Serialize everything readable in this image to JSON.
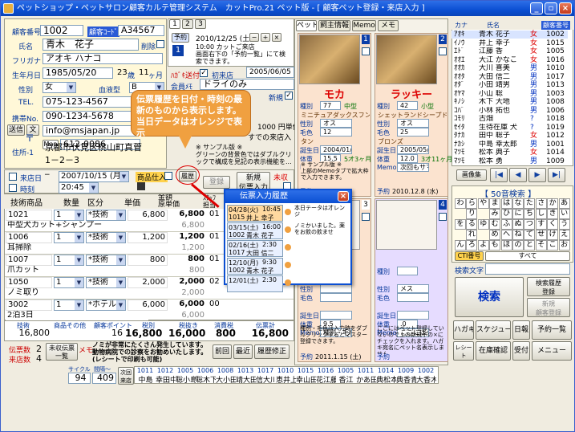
{
  "window": {
    "title": "ペットショップ・ペットサロン顧客カルテ管理システム　カットPro.21 ペット版 - [ 顧客ペット登録・来店入力 ]"
  },
  "customer": {
    "id_label": "顧客番号",
    "id": "1002",
    "code_label": "顧客ｺｰﾄﾞ",
    "code": "A34567",
    "name_label": "氏名",
    "name": "青木　花子",
    "delete_label": "削除",
    "kana_label": "フリガナ",
    "kana": "アオキ ハナコ",
    "birth_label": "生年月日",
    "birth": "1985/05/20",
    "age": "23",
    "age_unit": "歳",
    "months": "11",
    "month_unit": "ヶ月",
    "gender_label": "性別",
    "gender": "女",
    "blood_label": "血液型",
    "blood": "B",
    "dm_label": "ﾊｶﾞｷ送付",
    "first_visit_label": "初来店",
    "first_visit": "2005/06/05",
    "memo_label": "会員ﾒﾓ",
    "memo": "ドライのみ",
    "tel_label": "TEL.",
    "tel": "075-123-4567",
    "new_label": "新規",
    "mobile_label": "携帯No.",
    "mobile": "090-1234-5678",
    "mail_label": "送信",
    "mail_btn": "文",
    "mail": "info@msjapan.jp",
    "zip_label": "〒",
    "map_btn": "Map",
    "zip": "612-0086",
    "addr1_label": "住所-1",
    "addr1": "京都市伏見区桃山町真菅",
    "addr2": "1－2－3",
    "points_hint": "1000 円単位",
    "deferred_label": "すでの来店入"
  },
  "reservation": {
    "tabs": [
      "1",
      "2",
      "3"
    ],
    "btn": "予約",
    "date": "2010/12/25 (土)",
    "note": "10:00 カットご来店\n画面右下の「予約一覧」にて検索できます。"
  },
  "callout": {
    "text": "伝票履歴を日付・時刻の最新のものから表示します。当日データはオレンジで表示"
  },
  "sample_note": "※ サンプル版 ※\nグリーンの背景色ではダブルクリックで構成を見記の表示機能を...",
  "visit": {
    "date_label": "来店日",
    "date": "2007/10/15 (月)",
    "time_label": "時刻",
    "time": "20:45",
    "sales_btn": "商品仕入",
    "history_btn": "履歴",
    "register_btn": "登録",
    "new_slip_btn": "新規\n伝票入力",
    "unregistered_label": "未収"
  },
  "items": {
    "headers": [
      "技術商品",
      "数量",
      "区分",
      "単価",
      "金額\n原単価",
      "ｽﾀｯﾌ\n担当"
    ],
    "rows": [
      {
        "code": "1021",
        "qty": "1",
        "kind": "*技術",
        "price": "6,800",
        "amount": "6,800",
        "cost": "6,800",
        "staff": "01",
        "name": "中型犬カット+シャンプー"
      },
      {
        "code": "1006",
        "qty": "1",
        "kind": "*技術",
        "price": "1,200",
        "amount": "1,200",
        "cost": "1,200",
        "staff": "01",
        "name": "耳掃除"
      },
      {
        "code": "1007",
        "qty": "1",
        "kind": "*技術",
        "price": "800",
        "amount": "800",
        "cost": "800",
        "staff": "01",
        "name": "爪カット"
      },
      {
        "code": "1050",
        "qty": "1",
        "kind": "*技術",
        "price": "2,000",
        "amount": "2,000",
        "cost": "2,000",
        "staff": "02",
        "name": "ノミ取り"
      },
      {
        "code": "3002",
        "qty": "1",
        "kind": "*ホテル",
        "price": "6,000",
        "amount": "6,000",
        "cost": "6,000",
        "staff": "00",
        "name": "2泊3日"
      }
    ]
  },
  "totals": {
    "labels": [
      "技術",
      "商品その他",
      "顧客ポイント",
      "税別",
      "税抜き",
      "消費税",
      "伝票計"
    ],
    "tech": "16,800",
    "points": "16",
    "subtotal": "16,800",
    "net": "16,000",
    "tax": "800",
    "total": "16,800"
  },
  "footer_left": {
    "slips_label": "伝票数",
    "slips": "2",
    "unpaid_btn": "未収伝票\n一覧",
    "memo_label": "メモ",
    "memo": "ノミが非常にたくさん発生しています。動物病院での診察をお勧めいたします。(レシートで印刷も可能)",
    "visits_label": "来店数",
    "visits": "4",
    "btn_prev": "前回",
    "btn_recent": "最近",
    "btn_fix": "履歴修正"
  },
  "counter": {
    "cycle_label": "サイクル",
    "cycle": "94",
    "interval_label": "間隔～",
    "interval": "409",
    "next_btn": "次回\n来店日"
  },
  "history_popup": {
    "title": "伝票入力履歴",
    "rows": [
      {
        "date": "04/28(火)",
        "time": "10:45",
        "name": "",
        "today": true
      },
      {
        "date": "1015",
        "time": "",
        "name": "井上 幸子",
        "today": false
      },
      {
        "date": "03/15(土)",
        "time": "16:00",
        "name": "",
        "today": false
      },
      {
        "date": "1002",
        "time": "",
        "name": "青木 花子",
        "today": false
      },
      {
        "date": "02/16(土)",
        "time": "2:30",
        "name": "",
        "today": false
      },
      {
        "date": "1017",
        "time": "",
        "name": "大田 信二",
        "today": false
      },
      {
        "date": "12/10(月)",
        "time": "9:30",
        "name": "",
        "today": false
      },
      {
        "date": "1002",
        "time": "",
        "name": "青木 花子",
        "today": false
      },
      {
        "date": "12/01(土)",
        "time": "2:30",
        "name": "",
        "today": false
      }
    ],
    "memos": [
      "本日テータは才レンジ",
      "ノミかいました。薬をお飲の飲ませ",
      "",
      ""
    ],
    "close": "×"
  },
  "pet_tabs": [
    "ペット",
    "飼主情報",
    "Memo",
    "メモ"
  ],
  "pets": [
    {
      "name": "モカ",
      "no": "1",
      "breed_label": "種別",
      "breed": "77",
      "size": "中型",
      "breed_name": "ミニチュアダックスフンド",
      "sex_label": "性別",
      "sex": "オス",
      "color_label": "毛色",
      "color": "12",
      "color_name": "タン",
      "birth_label": "誕生日",
      "birth": "2004/01/08",
      "age": "4 歳",
      "weight_label": "体重",
      "weight": "15.5",
      "months": "5才3ヶ月",
      "memo_label": "Memo",
      "memo": "耳掃除必須",
      "reserve_label": "予約",
      "reserve": ""
    },
    {
      "name": "ラッキー",
      "no": "2",
      "breed_label": "種別",
      "breed": "42",
      "size": "小型",
      "breed_name": "シェットランドシープドッグ",
      "sex_label": "性別",
      "sex": "オス",
      "color_label": "毛色",
      "color": "25",
      "color_name": "ブロンズ",
      "birth_label": "誕生日",
      "birth": "2005/05/07",
      "age": "",
      "weight_label": "体重",
      "weight": "12.0",
      "months": "3才11ヶ月",
      "memo_label": "Memo",
      "memo": "次回もサマーカットで",
      "reserve_label": "予約",
      "reserve": "2010.12.8 (水)"
    },
    {
      "name": "",
      "no": "3",
      "breed_label": "種別",
      "breed": "",
      "size": "",
      "breed_name": "",
      "sex_label": "性別",
      "sex": "",
      "color_label": "毛色",
      "color": "",
      "color_name": "",
      "birth_label": "誕生日",
      "birth": "",
      "age": "",
      "weight_label": "体重",
      "weight": "9.5",
      "months": "",
      "memo_label": "Memo",
      "memo": "種別・毛色は入力時をダブルクリックするとマスター登録できます。",
      "reserve_label": "予約",
      "reserve": "2011.1.15 (土)"
    },
    {
      "name": "",
      "no": "4",
      "breed_label": "種別",
      "breed": "",
      "size": "",
      "breed_name": "",
      "sex_label": "性別",
      "sex": "メス",
      "color_label": "毛色",
      "color": "",
      "color_name": "",
      "birth_label": "誕生日",
      "birth": "",
      "age": "",
      "weight_label": "体重",
      "weight": ".0",
      "months": "",
      "memo_label": "Memo",
      "memo": "ここにはペット登録していないので上の新規予の×にチェックを入れます。ハガキ宛名にペット名表示しません。",
      "reserve_label": "予約",
      "reserve": ""
    }
  ],
  "pet_sample_note": "※ サンプル版 ※\n上部のMemoタブで拡大枠で入力できます。",
  "customer_list": {
    "headers": [
      "カナ",
      "氏名",
      "顧客番号"
    ],
    "rows": [
      {
        "kana": "ｱｵｷ",
        "name": "青木 花子",
        "sex": "女",
        "no": "1002"
      },
      {
        "kana": "ｲﾉｳ",
        "name": "井上 幸子",
        "sex": "女",
        "no": "1015"
      },
      {
        "kana": "ｴﾄﾞ",
        "name": "江藤 香",
        "sex": "女",
        "no": "1005"
      },
      {
        "kana": "ｵｵｴ",
        "name": "大江 かなこ",
        "sex": "女",
        "no": "1016"
      },
      {
        "kana": "ｵｵｶ",
        "name": "大川 喜美",
        "sex": "男",
        "no": "1010"
      },
      {
        "kana": "ｵｵﾀ",
        "name": "大田 信二",
        "sex": "男",
        "no": "1017"
      },
      {
        "kana": "ｵﾀﾞ",
        "name": "小田 靖男",
        "sex": "男",
        "no": "1013"
      },
      {
        "kana": "ｵﾔﾏ",
        "name": "小山 聡",
        "sex": "男",
        "no": "1003"
      },
      {
        "kana": "ｷﾉｼ",
        "name": "木下 大地",
        "sex": "男",
        "no": "1008"
      },
      {
        "kana": "ｺﾊﾞ",
        "name": "小林 拓也",
        "sex": "男",
        "no": "1006"
      },
      {
        "kana": "ｺﾓﾘ",
        "name": "古畑",
        "sex": "?",
        "no": "1018"
      },
      {
        "kana": "ｾｲﾀ",
        "name": "生待在庫 犬",
        "sex": "?",
        "no": "1019"
      },
      {
        "kana": "ﾀﾅｶ",
        "name": "田中 聡子",
        "sex": "女",
        "no": "1012"
      },
      {
        "kana": "ﾅｶｼ",
        "name": "中島 幸太郎",
        "sex": "男",
        "no": "1001"
      },
      {
        "kana": "ﾏﾂﾓ",
        "name": "松本 典子",
        "sex": "女",
        "no": "1014"
      },
      {
        "kana": "ﾏﾂﾓ",
        "name": "松本 勇",
        "sex": "男",
        "no": "1009"
      }
    ]
  },
  "nav": {
    "image_btn": "画像集",
    "first": "|◀",
    "prev": "◀",
    "next": "▶",
    "last": "▶|"
  },
  "kana_search": {
    "title": "【 50音検索 】",
    "keys": [
      "わ",
      "ら",
      "や",
      "ま",
      "は",
      "な",
      "た",
      "さ",
      "か",
      "あ",
      "",
      "り",
      "",
      "み",
      "ひ",
      "に",
      "ち",
      "し",
      "き",
      "い",
      "を",
      "る",
      "ゆ",
      "む",
      "ふ",
      "ぬ",
      "つ",
      "す",
      "く",
      "う",
      "",
      "れ",
      "",
      "め",
      "へ",
      "ね",
      "て",
      "せ",
      "け",
      "え",
      "ん",
      "ろ",
      "よ",
      "も",
      "ほ",
      "の",
      "と",
      "そ",
      "こ",
      "お"
    ],
    "cti_btn": "CTI番号",
    "all_btn": "すべて",
    "search_label": "検索文字",
    "search_btn": "検索",
    "history_btn": "検索履歴\n登録",
    "new_btn": "新規\n顧客登録"
  },
  "bottom_btns": {
    "hagaki": "ハガキ",
    "schedule": "スケジュール",
    "daily": "日報",
    "reserve": "予約一覧",
    "receipt": "レシート\n領収書",
    "stock": "在庫確認",
    "reception": "受付",
    "menu": "メニュー"
  },
  "recent_visitors": [
    {
      "no": "1011",
      "name": "中島"
    },
    {
      "no": "1012",
      "name": "幸田中"
    },
    {
      "no": "1005",
      "name": "聡小島"
    },
    {
      "no": "1006",
      "name": "聡木下"
    },
    {
      "no": "1008",
      "name": "大小田"
    },
    {
      "no": "1013",
      "name": "靖大田"
    },
    {
      "no": "1017",
      "name": "信大川"
    },
    {
      "no": "1010",
      "name": "恵井上"
    },
    {
      "no": "1015",
      "name": "幸山田"
    },
    {
      "no": "1016",
      "name": "花江藤"
    },
    {
      "no": "1005",
      "name": "香江"
    },
    {
      "no": "1011",
      "name": "かあ田"
    },
    {
      "no": "1014",
      "name": "典松本"
    },
    {
      "no": "1009",
      "name": "典香青木"
    },
    {
      "no": "1002",
      "name": "大香木"
    }
  ]
}
